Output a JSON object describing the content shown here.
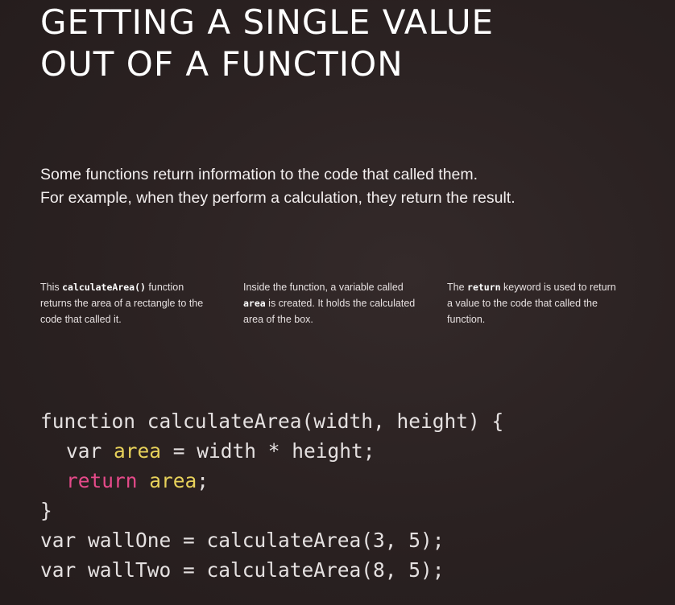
{
  "title": {
    "line1": "GETTING A SINGLE VALUE",
    "line2": "OUT OF A FUNCTION"
  },
  "intro": {
    "line1": "Some functions return information to the code that called them.",
    "line2": "For example, when they perform a calculation, they return the result."
  },
  "notes": [
    {
      "before": "This ",
      "code": "calculateArea()",
      "after": " function returns the area of a rectangle to the code that called it."
    },
    {
      "before": "Inside the function, a variable called ",
      "code": "area",
      "after": " is created. It holds the calculated area of the box."
    },
    {
      "before": "The ",
      "code": "return",
      "after": " keyword is used to return a value to the code that called the function."
    }
  ],
  "code": {
    "line1": "function calculateArea(width, height) {",
    "line2_var": "var ",
    "line2_area": "area",
    "line2_rest": " = width * height;",
    "line3_return": "return",
    "line3_space": " ",
    "line3_area": "area",
    "line3_semi": ";",
    "line4": "}",
    "line5": "var wallOne = calculateArea(3, 5);",
    "line6": "var wallTwo = calculateArea(8, 5);"
  },
  "colors": {
    "background": "#2b2222",
    "highlight_yellow": "#e7d15a",
    "highlight_pink": "#e64a8a"
  }
}
